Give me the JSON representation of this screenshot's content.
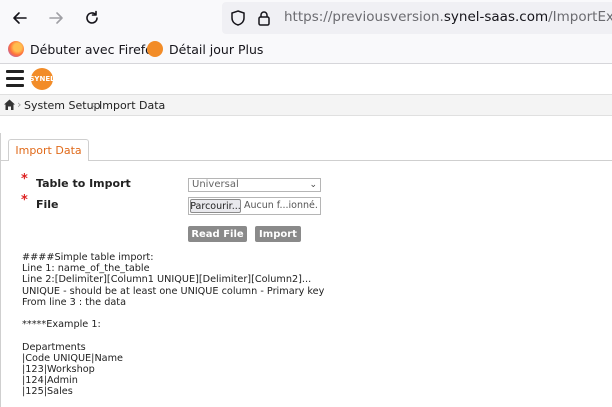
{
  "browser": {
    "url_prefix": "https://previousversion.",
    "url_host": "synel-saas.com",
    "url_path": "/ImportExport",
    "bookmarks": [
      {
        "label": "Débuter avec Firefox"
      },
      {
        "label": "Détail jour Plus"
      }
    ]
  },
  "app": {
    "logo_text": "SYNEL",
    "breadcrumb": [
      "System Setup",
      "Import Data"
    ]
  },
  "tab": {
    "label": "Import Data"
  },
  "form": {
    "required_mark": "*",
    "table_label": "Table to Import",
    "table_value": "Universal",
    "file_label": "File",
    "file_button": "Parcourir...",
    "file_status": "Aucun f...ionné.",
    "read_file_label": "Read File",
    "import_label": "Import"
  },
  "instructions": [
    "####Simple table import:",
    "Line 1: name_of_the_table",
    "Line 2:[Delimiter][Column1 UNIQUE][Delimiter][Column2]...",
    "UNIQUE - should be at least one UNIQUE column - Primary key",
    "From line 3 : the data",
    "",
    "*****Example 1:",
    "",
    "Departments",
    "|Code UNIQUE|Name",
    "|123|Workshop",
    "|124|Admin",
    "|125|Sales"
  ]
}
